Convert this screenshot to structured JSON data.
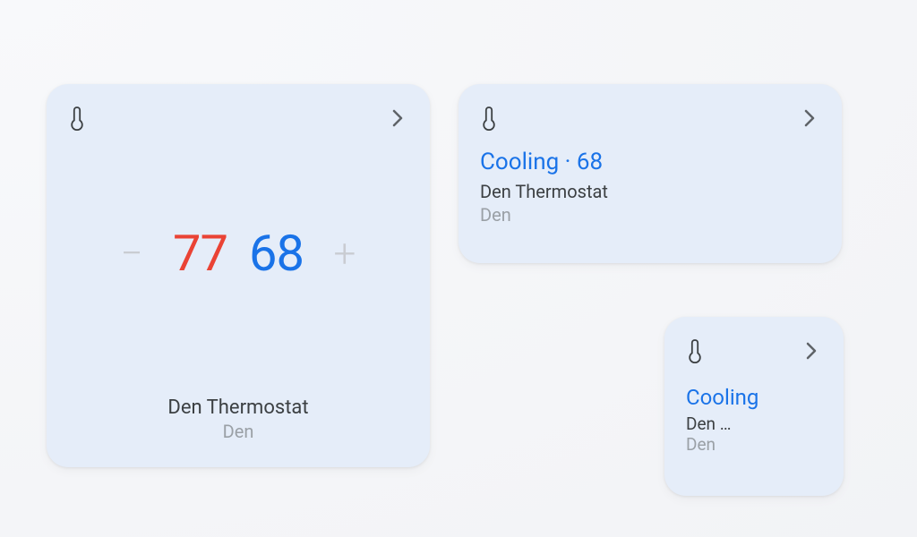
{
  "large_card": {
    "heat_setpoint": "77",
    "cool_setpoint": "68",
    "decrease_symbol": "−",
    "increase_symbol": "+",
    "device_name": "Den Thermostat",
    "room": "Den"
  },
  "medium_card": {
    "status_line": "Cooling · 68",
    "device_name": "Den Thermostat",
    "room": "Den"
  },
  "small_card": {
    "status_line": "Cooling",
    "device_name": "Den …",
    "room": "Den"
  },
  "colors": {
    "heat": "#ea4335",
    "cool": "#1a73e8",
    "card_bg": "#e5edf9",
    "muted": "#9aa0a6"
  }
}
